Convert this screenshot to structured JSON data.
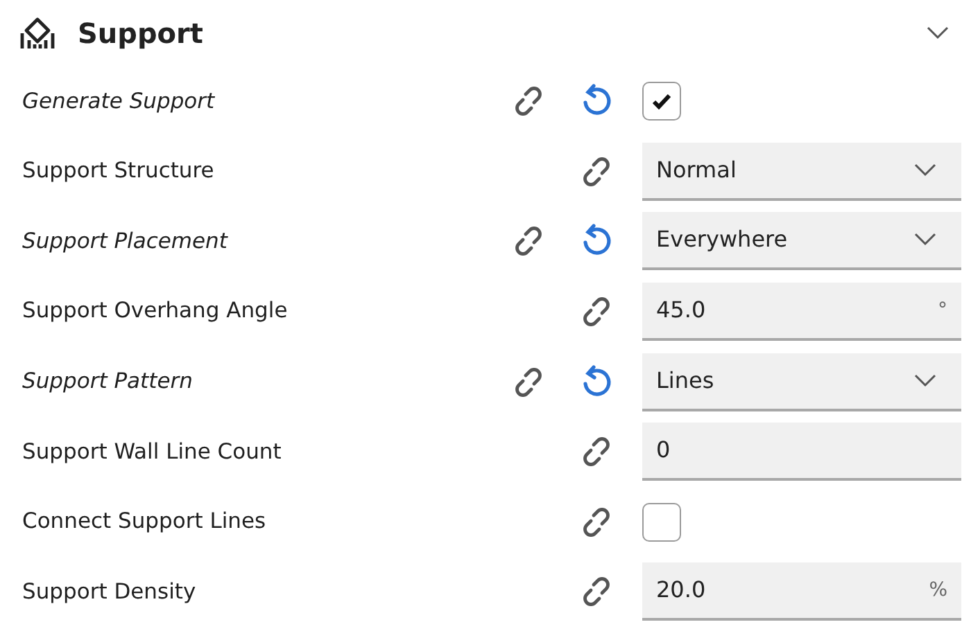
{
  "section": {
    "title": "Support",
    "expanded": true
  },
  "settings": [
    {
      "label": "Generate Support",
      "modified": true,
      "kind": "checkbox",
      "checked": true
    },
    {
      "label": "Support Structure",
      "modified": false,
      "kind": "dropdown",
      "value": "Normal"
    },
    {
      "label": "Support Placement",
      "modified": true,
      "kind": "dropdown",
      "value": "Everywhere"
    },
    {
      "label": "Support Overhang Angle",
      "modified": false,
      "kind": "number",
      "value": "45.0",
      "unit": "°"
    },
    {
      "label": "Support Pattern",
      "modified": true,
      "kind": "dropdown",
      "value": "Lines"
    },
    {
      "label": "Support Wall Line Count",
      "modified": false,
      "kind": "number",
      "value": "0"
    },
    {
      "label": "Connect Support Lines",
      "modified": false,
      "kind": "checkbox",
      "checked": false
    },
    {
      "label": "Support Density",
      "modified": false,
      "kind": "number",
      "value": "20.0",
      "unit": "%"
    }
  ]
}
